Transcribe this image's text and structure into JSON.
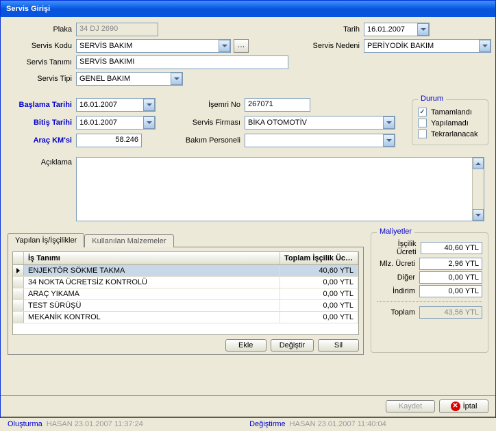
{
  "title": "Servis Girişi",
  "labels": {
    "plaka": "Plaka",
    "tarih": "Tarih",
    "servisKodu": "Servis Kodu",
    "servisNedeni": "Servis Nedeni",
    "servisTanimi": "Servis Tanımı",
    "servisTipi": "Servis Tipi",
    "baslamaTarihi": "Başlama Tarihi",
    "bitisTarihi": "Bitiş Tarihi",
    "aracKm": "Araç KM'si",
    "isemriNo": "İşemri No",
    "servisFirmasi": "Servis Firması",
    "bakimPersoneli": "Bakım Personeli",
    "aciklama": "Açıklama"
  },
  "values": {
    "plaka": "34 DJ 2690",
    "tarih": "16.01.2007",
    "servisKodu": "SERVİS BAKIM",
    "servisNedeni": "PERİYODİK BAKIM",
    "servisTanimi": "SERVİS BAKIMI",
    "servisTipi": "GENEL BAKIM",
    "baslamaTarihi": "16.01.2007",
    "bitisTarihi": "16.01.2007",
    "aracKm": "58.246",
    "isemriNo": "267071",
    "servisFirmasi": "BİKA OTOMOTİV",
    "bakimPersoneli": ""
  },
  "durum": {
    "title": "Durum",
    "items": [
      {
        "label": "Tamamlandı",
        "checked": true
      },
      {
        "label": "Yapılamadı",
        "checked": false
      },
      {
        "label": "Tekrarlanacak",
        "checked": false
      }
    ]
  },
  "tabs": {
    "yapilan": "Yapılan İş/İşçilikler",
    "kullanilan": "Kullanılan Malzemeler"
  },
  "grid": {
    "headers": {
      "isTanimi": "İş Tanımı",
      "toplam": "Toplam İşçilik Üc…"
    },
    "rows": [
      {
        "name": "ENJEKTÖR SÖKME TAKMA",
        "cost": "40,60 YTL",
        "selected": true
      },
      {
        "name": "34 NOKTA ÜCRETSİZ KONTROLÜ",
        "cost": "0,00 YTL",
        "selected": false
      },
      {
        "name": "ARAÇ YIKAMA",
        "cost": "0,00 YTL",
        "selected": false
      },
      {
        "name": "TEST SÜRÜŞÜ",
        "cost": "0,00 YTL",
        "selected": false
      },
      {
        "name": "MEKANİK KONTROL",
        "cost": "0,00 YTL",
        "selected": false
      }
    ]
  },
  "gridButtons": {
    "ekle": "Ekle",
    "degistir": "Değiştir",
    "sil": "Sil"
  },
  "maliyetler": {
    "title": "Maliyetler",
    "rows": {
      "iscilik": {
        "label": "İşçilik Ücreti",
        "value": "40,60 YTL"
      },
      "malzeme": {
        "label": "Mlz. Ücreti",
        "value": "2,96 YTL"
      },
      "diger": {
        "label": "Diğer",
        "value": "0,00 YTL"
      },
      "indirim": {
        "label": "İndirim",
        "value": "0,00 YTL"
      },
      "toplam": {
        "label": "Toplam",
        "value": "43,56 YTL"
      }
    }
  },
  "buttons": {
    "kaydet": "Kaydet",
    "iptal": "İptal"
  },
  "status": {
    "olusturmaLabel": "Oluşturma",
    "olusturmaValue": "HASAN 23.01.2007 11:37:24",
    "degistirmeLabel": "Değiştirme",
    "degistirmeValue": "HASAN 23.01.2007 11:40:04"
  }
}
